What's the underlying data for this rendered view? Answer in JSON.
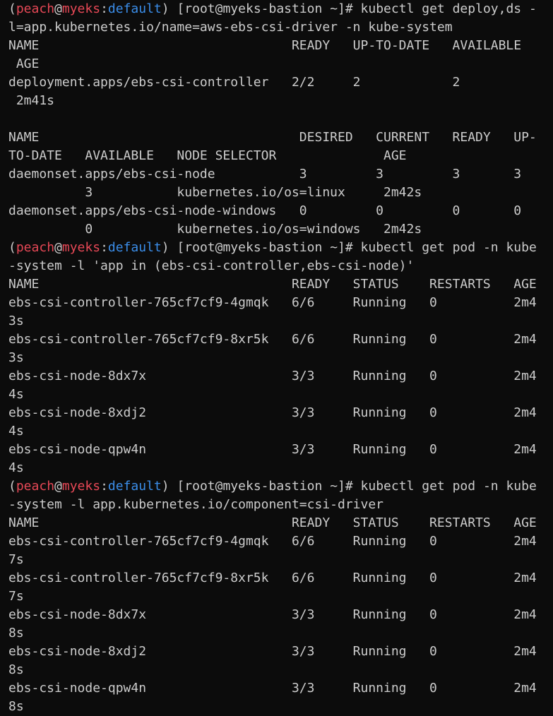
{
  "colors": {
    "background": "#0c0c0c",
    "text": "#cccccc",
    "prompt_user": "#e74856",
    "prompt_context": "#3b8eea"
  },
  "prompt": {
    "open": "(",
    "user": "peach",
    "at": "@",
    "host": "myeks",
    "colon": ":",
    "context": "default",
    "close": ") ",
    "shell": "[root@myeks-bastion ~]# "
  },
  "lines": [
    {
      "type": "command",
      "text": "kubectl get deploy,ds -"
    },
    {
      "type": "output",
      "text": "l=app.kubernetes.io/name=aws-ebs-csi-driver -n kube-system"
    },
    {
      "type": "output",
      "text": "NAME                                 READY   UP-TO-DATE   AVAILABLE"
    },
    {
      "type": "output",
      "text": " AGE"
    },
    {
      "type": "output",
      "text": "deployment.apps/ebs-csi-controller   2/2     2            2"
    },
    {
      "type": "output",
      "text": " 2m41s"
    },
    {
      "type": "output",
      "text": ""
    },
    {
      "type": "output",
      "text": "NAME                                  DESIRED   CURRENT   READY   UP-"
    },
    {
      "type": "output",
      "text": "TO-DATE   AVAILABLE   NODE SELECTOR              AGE"
    },
    {
      "type": "output",
      "text": "daemonset.apps/ebs-csi-node           3         3         3       3"
    },
    {
      "type": "output",
      "text": "          3           kubernetes.io/os=linux     2m42s"
    },
    {
      "type": "output",
      "text": "daemonset.apps/ebs-csi-node-windows   0         0         0       0"
    },
    {
      "type": "output",
      "text": "          0           kubernetes.io/os=windows   2m42s"
    },
    {
      "type": "command",
      "text": "kubectl get pod -n kube"
    },
    {
      "type": "output",
      "text": "-system -l 'app in (ebs-csi-controller,ebs-csi-node)'"
    },
    {
      "type": "output",
      "text": "NAME                                 READY   STATUS    RESTARTS   AGE"
    },
    {
      "type": "output",
      "text": "ebs-csi-controller-765cf7cf9-4gmqk   6/6     Running   0          2m4"
    },
    {
      "type": "output",
      "text": "3s"
    },
    {
      "type": "output",
      "text": "ebs-csi-controller-765cf7cf9-8xr5k   6/6     Running   0          2m4"
    },
    {
      "type": "output",
      "text": "3s"
    },
    {
      "type": "output",
      "text": "ebs-csi-node-8dx7x                   3/3     Running   0          2m4"
    },
    {
      "type": "output",
      "text": "4s"
    },
    {
      "type": "output",
      "text": "ebs-csi-node-8xdj2                   3/3     Running   0          2m4"
    },
    {
      "type": "output",
      "text": "4s"
    },
    {
      "type": "output",
      "text": "ebs-csi-node-qpw4n                   3/3     Running   0          2m4"
    },
    {
      "type": "output",
      "text": "4s"
    },
    {
      "type": "command",
      "text": "kubectl get pod -n kube"
    },
    {
      "type": "output",
      "text": "-system -l app.kubernetes.io/component=csi-driver"
    },
    {
      "type": "output",
      "text": "NAME                                 READY   STATUS    RESTARTS   AGE"
    },
    {
      "type": "output",
      "text": "ebs-csi-controller-765cf7cf9-4gmqk   6/6     Running   0          2m4"
    },
    {
      "type": "output",
      "text": "7s"
    },
    {
      "type": "output",
      "text": "ebs-csi-controller-765cf7cf9-8xr5k   6/6     Running   0          2m4"
    },
    {
      "type": "output",
      "text": "7s"
    },
    {
      "type": "output",
      "text": "ebs-csi-node-8dx7x                   3/3     Running   0          2m4"
    },
    {
      "type": "output",
      "text": "8s"
    },
    {
      "type": "output",
      "text": "ebs-csi-node-8xdj2                   3/3     Running   0          2m4"
    },
    {
      "type": "output",
      "text": "8s"
    },
    {
      "type": "output",
      "text": "ebs-csi-node-qpw4n                   3/3     Running   0          2m4"
    },
    {
      "type": "output",
      "text": "8s"
    }
  ]
}
